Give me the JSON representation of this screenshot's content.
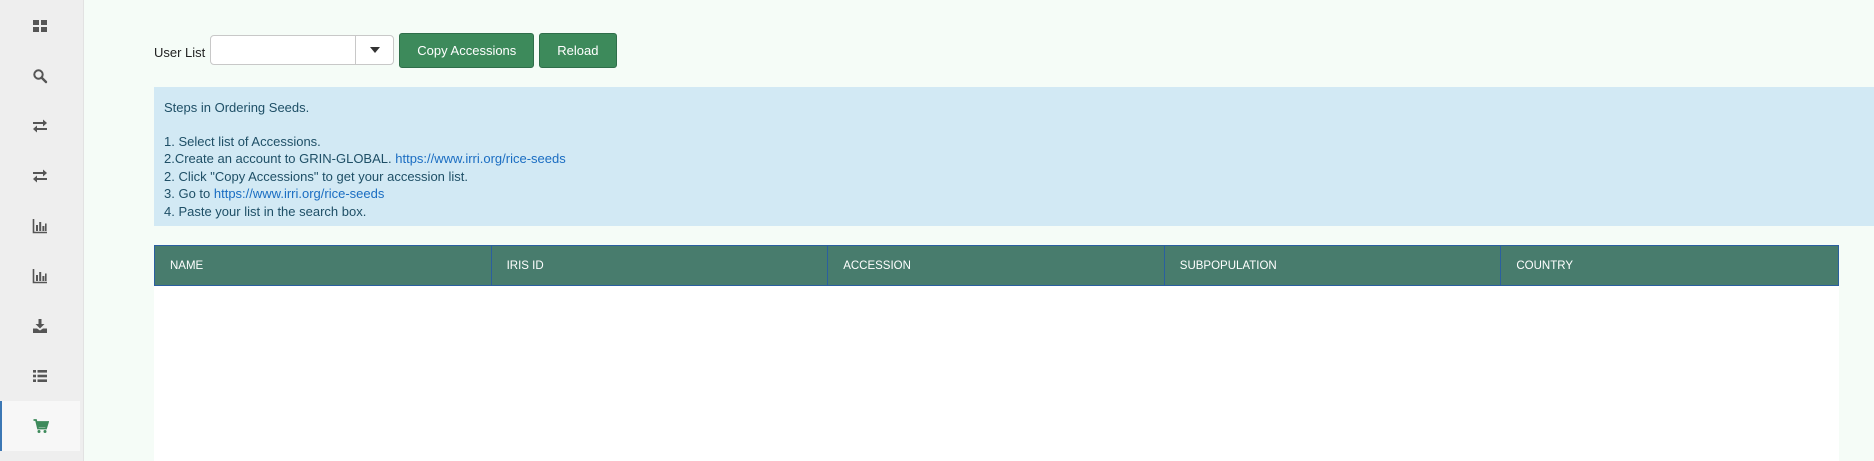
{
  "sidebar": {
    "items": [
      {
        "icon": "dashboard-icon"
      },
      {
        "icon": "search-icon"
      },
      {
        "icon": "exchange-icon"
      },
      {
        "icon": "exchange-icon"
      },
      {
        "icon": "bar-chart-icon"
      },
      {
        "icon": "bar-chart-icon"
      },
      {
        "icon": "download-icon"
      },
      {
        "icon": "list-icon"
      },
      {
        "icon": "cart-icon",
        "active": true
      }
    ],
    "active_color": "#3d8a5b",
    "icon_color": "#555555"
  },
  "toolbar": {
    "user_list_label": "User List",
    "user_list_value": "",
    "copy_label": "Copy Accessions",
    "reload_label": "Reload"
  },
  "info": {
    "title": "Steps in Ordering Seeds.",
    "step1": "1. Select list of Accessions.",
    "step2_text": "2.Create an account to GRIN-GLOBAL. ",
    "step2_link": "https://www.irri.org/rice-seeds",
    "step3": "2. Click \"Copy Accessions\" to get your accession list.",
    "step4_text": "3. Go to ",
    "step4_link": "https://www.irri.org/rice-seeds",
    "step5": "4. Paste your list in the search box."
  },
  "table": {
    "columns": [
      "NAME",
      "IRIS ID",
      "ACCESSION",
      "SUBPOPULATION",
      "COUNTRY"
    ],
    "rows": []
  },
  "colors": {
    "header_bg": "#487c6d",
    "button_bg": "#3d8a5b",
    "info_bg": "#d2e9f4",
    "link": "#1a6dc2"
  }
}
